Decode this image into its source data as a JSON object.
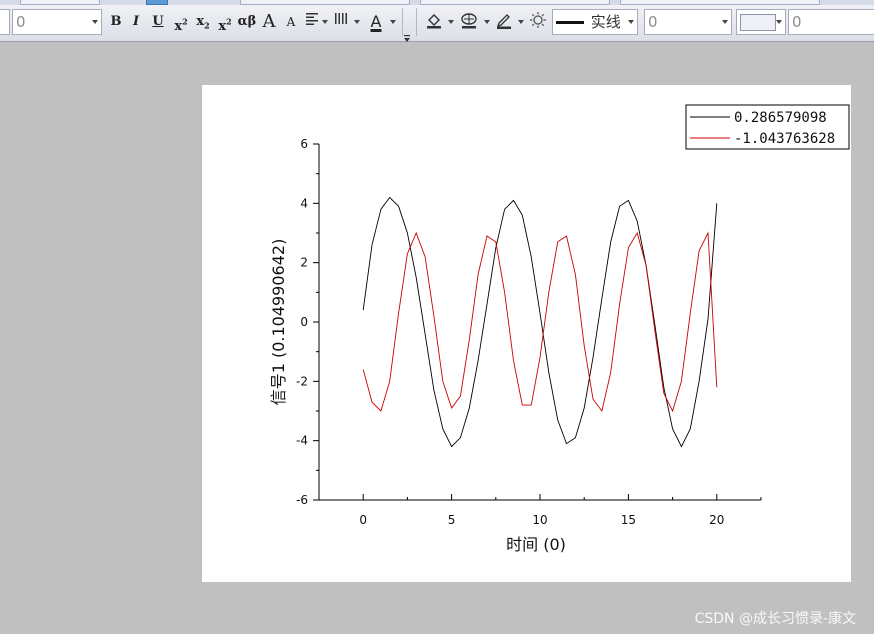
{
  "toolbar": {
    "font_size_value": "0",
    "bold_label": "B",
    "italic_label": "I",
    "underline_label": "U",
    "greek_label": "αβ",
    "grow_font_label": "A",
    "shrink_font_label": "A",
    "font_color_label": "A",
    "line_style_label": "实线",
    "line_width_value": "0",
    "pattern_value": "0"
  },
  "chart_data": {
    "type": "line",
    "xlabel": "时间 (0)",
    "ylabel": "信号1 (0.104990642)",
    "xlim": [
      -2.5,
      22.5
    ],
    "ylim": [
      -6,
      6
    ],
    "xticks": [
      0,
      5,
      10,
      15,
      20
    ],
    "yticks": [
      -6,
      -4,
      -2,
      0,
      2,
      4,
      6
    ],
    "grid": false,
    "legend_position": "top-right",
    "series": [
      {
        "name": "0.286579098",
        "color": "#000000",
        "x": [
          0,
          0.5,
          1,
          1.5,
          2,
          2.5,
          3,
          3.5,
          4,
          4.5,
          5,
          5.5,
          6,
          6.5,
          7,
          7.5,
          8,
          8.5,
          9,
          9.5,
          10,
          10.5,
          11,
          11.5,
          12,
          12.5,
          13,
          13.5,
          14,
          14.5,
          15,
          15.5,
          16,
          16.5,
          17,
          17.5,
          18,
          18.5,
          19,
          19.5,
          20
        ],
        "y": [
          0.4,
          2.6,
          3.8,
          4.2,
          3.9,
          3.0,
          1.5,
          -0.4,
          -2.3,
          -3.6,
          -4.2,
          -3.9,
          -2.9,
          -1.3,
          0.6,
          2.5,
          3.8,
          4.1,
          3.6,
          2.2,
          0.3,
          -1.7,
          -3.3,
          -4.1,
          -3.9,
          -2.9,
          -1.2,
          0.8,
          2.7,
          3.9,
          4.1,
          3.4,
          1.9,
          -0.1,
          -2.2,
          -3.6,
          -4.2,
          -3.6,
          -2.0,
          0.1,
          4.0
        ]
      },
      {
        "name": "-1.043763628",
        "color": "#cc0000",
        "x": [
          0,
          0.5,
          1,
          1.5,
          2,
          2.5,
          3,
          3.5,
          4,
          4.5,
          5,
          5.5,
          6,
          6.5,
          7,
          7.5,
          8,
          8.5,
          9,
          9.5,
          10,
          10.5,
          11,
          11.5,
          12,
          12.5,
          13,
          13.5,
          14,
          14.5,
          15,
          15.5,
          16,
          16.5,
          17,
          17.5,
          18,
          18.5,
          19,
          19.5,
          20
        ],
        "y": [
          -1.6,
          -2.7,
          -3.0,
          -2.0,
          0.3,
          2.3,
          3.0,
          2.2,
          0.2,
          -2.0,
          -2.9,
          -2.5,
          -0.6,
          1.6,
          2.9,
          2.7,
          1.0,
          -1.3,
          -2.8,
          -2.8,
          -1.2,
          1.0,
          2.7,
          2.9,
          1.6,
          -0.8,
          -2.6,
          -3.0,
          -1.7,
          0.6,
          2.5,
          3.0,
          1.9,
          -0.3,
          -2.4,
          -3.0,
          -2.0,
          0.3,
          2.4,
          3.0,
          -2.2
        ]
      }
    ]
  },
  "watermark": "CSDN @成长习惯录-康文"
}
